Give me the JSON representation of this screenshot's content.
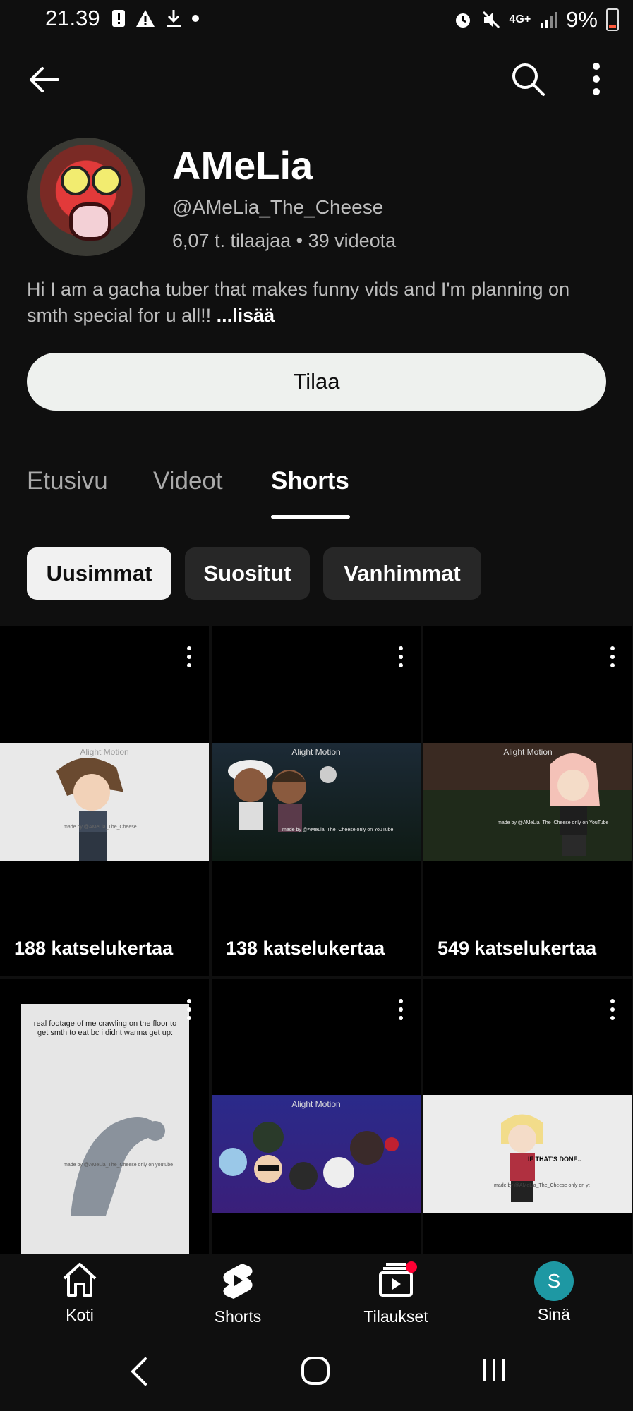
{
  "status_bar": {
    "time": "21.39",
    "battery": "9%",
    "network": "4G+"
  },
  "channel": {
    "name": "AMeLia",
    "handle": "@AMeLia_The_Cheese",
    "stats": "6,07 t. tilaajaa • 39 videota",
    "description": "Hi I am a gacha tuber that makes funny vids and I'm planning on smth special for u all!! ",
    "description_more": "...lisää",
    "subscribe_label": "Tilaa"
  },
  "tabs": [
    {
      "label": "Etusivu"
    },
    {
      "label": "Videot"
    },
    {
      "label": "Shorts"
    }
  ],
  "active_tab": "Shorts",
  "filters": [
    {
      "label": "Uusimmat"
    },
    {
      "label": "Suositut"
    },
    {
      "label": "Vanhimmat"
    }
  ],
  "active_filter": "Uusimmat",
  "shorts": [
    {
      "views": "188 katselukertaa",
      "watermark": "Alight Motion",
      "credit": "made by @AMeLia_The_Cheese"
    },
    {
      "views": "138 katselukertaa",
      "watermark": "Alight Motion",
      "credit": "made by @AMeLia_The_Cheese only on YouTube"
    },
    {
      "views": "549 katselukertaa",
      "watermark": "Alight Motion",
      "credit": "made by @AMeLia_The_Cheese only on YouTube"
    },
    {
      "views": "",
      "caption": "real footage of me crawling on the floor to get smth to eat bc i didnt wanna get up:",
      "credit": "made by @AMeLia_The_Cheese only on youtube"
    },
    {
      "views": "",
      "watermark": "Alight Motion"
    },
    {
      "views": "",
      "caption": "IF THAT'S DONE..",
      "credit": "made by @AMeLia_The_Cheese only on yt"
    }
  ],
  "bottom_nav": [
    {
      "label": "Koti",
      "icon": "home-icon"
    },
    {
      "label": "Shorts",
      "icon": "shorts-icon"
    },
    {
      "label": "Tilaukset",
      "icon": "subscriptions-icon"
    },
    {
      "label": "Sinä",
      "icon": "avatar",
      "avatar_letter": "S"
    }
  ],
  "colors": {
    "background": "#0f0f0f",
    "subscribe_bg": "#eef1ee",
    "avatar_s": "#1e98a3",
    "notification_dot": "#ff0033"
  }
}
